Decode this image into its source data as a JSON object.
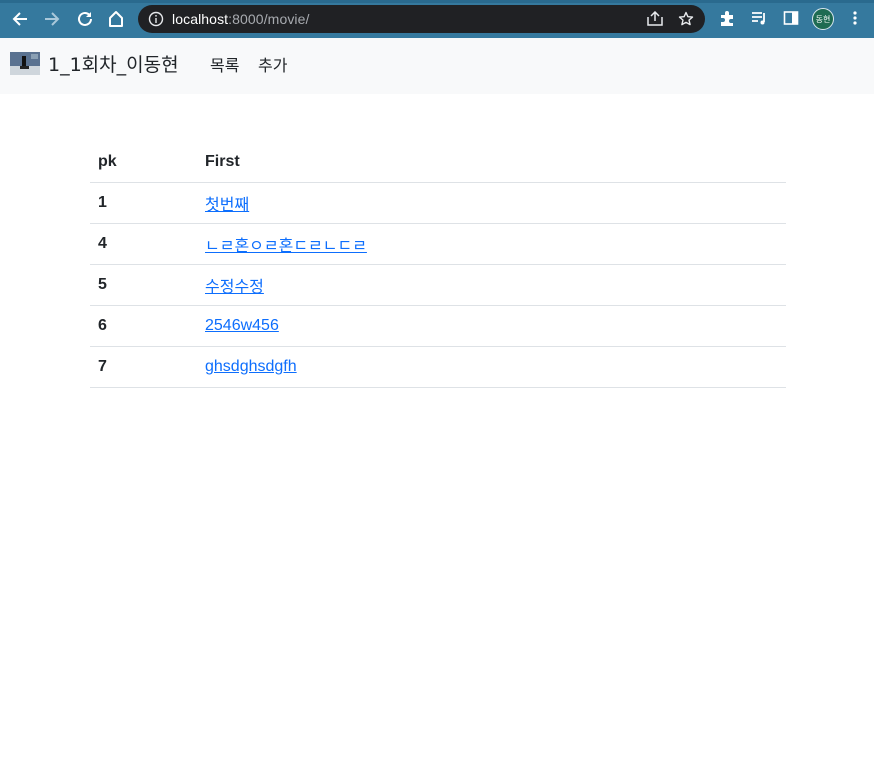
{
  "browser": {
    "url_host": "localhost",
    "url_rest": ":8000/movie/",
    "profile_initials": "동현"
  },
  "navbar": {
    "brand": "1_1회차_이동현",
    "links": [
      "목록",
      "추가"
    ]
  },
  "table": {
    "headers": [
      "pk",
      "First"
    ],
    "rows": [
      {
        "pk": "1",
        "title": "첫번째"
      },
      {
        "pk": "4",
        "title": "ㄴㄹ혼ㅇㄹ혼ㄷㄹㄴㄷㄹ"
      },
      {
        "pk": "5",
        "title": "수정수정"
      },
      {
        "pk": "6",
        "title": "2546w456"
      },
      {
        "pk": "7",
        "title": "ghsdghsdgfh"
      }
    ]
  }
}
